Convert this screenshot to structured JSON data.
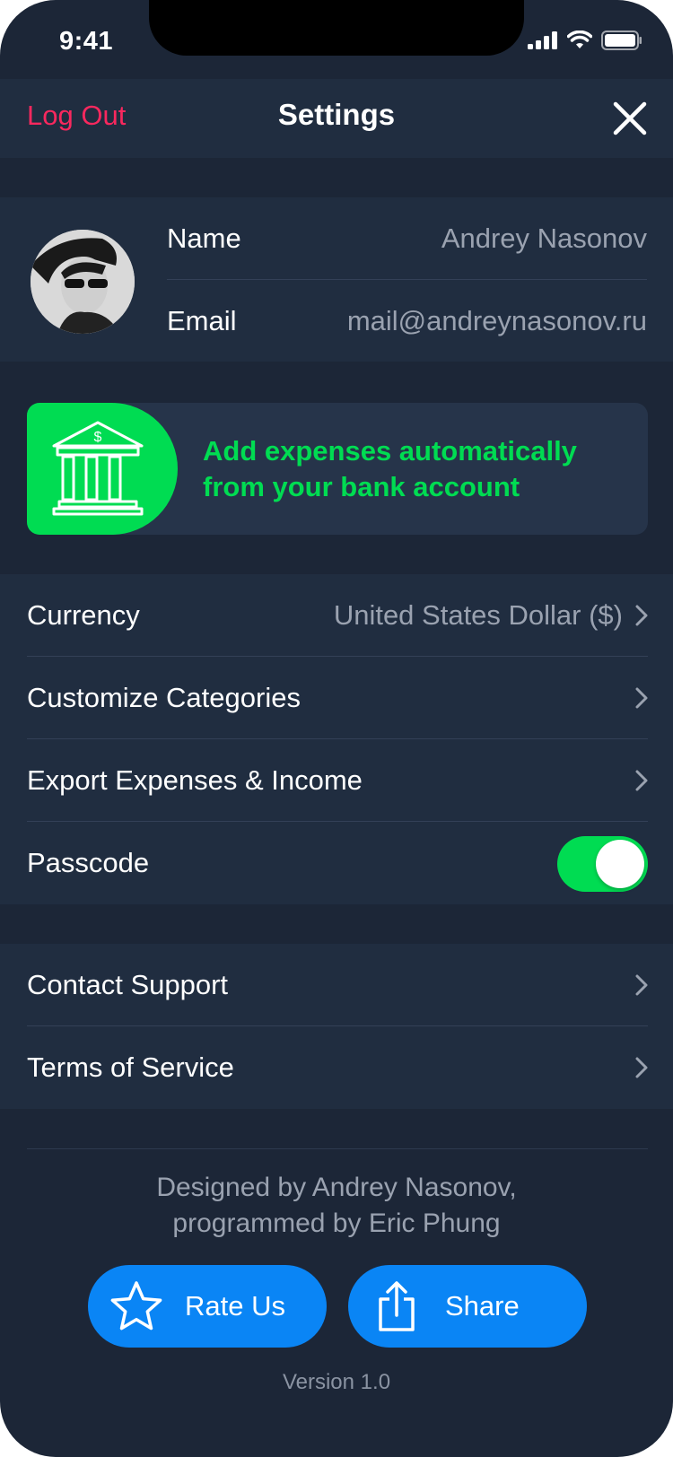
{
  "status": {
    "time": "9:41"
  },
  "nav": {
    "logout": "Log Out",
    "title": "Settings"
  },
  "profile": {
    "name_label": "Name",
    "name_value": "Andrey Nasonov",
    "email_label": "Email",
    "email_value": "mail@andreynasonov.ru"
  },
  "bank": {
    "line1": "Add expenses automatically",
    "line2": "from your bank account"
  },
  "settings": {
    "currency_label": "Currency",
    "currency_value": "United States Dollar ($)",
    "categories_label": "Customize Categories",
    "export_label": "Export Expenses & Income",
    "passcode_label": "Passcode",
    "passcode_enabled": true
  },
  "support": {
    "contact_label": "Contact Support",
    "terms_label": "Terms of Service"
  },
  "footer": {
    "credits_line1": "Designed by Andrey Nasonov,",
    "credits_line2": "programmed by Eric Phung",
    "rate_label": "Rate Us",
    "share_label": "Share",
    "version": "Version 1.0"
  },
  "colors": {
    "background": "#1c2637",
    "panel": "#202d40",
    "accent_red": "#f8285e",
    "accent_green": "#00dc52",
    "accent_blue": "#0a85f5",
    "secondary_text": "#9aa2b0"
  },
  "icons": [
    "signal-icon",
    "wifi-icon",
    "battery-icon",
    "close-icon",
    "bank-icon",
    "chevron-right-icon",
    "star-icon",
    "share-icon"
  ]
}
